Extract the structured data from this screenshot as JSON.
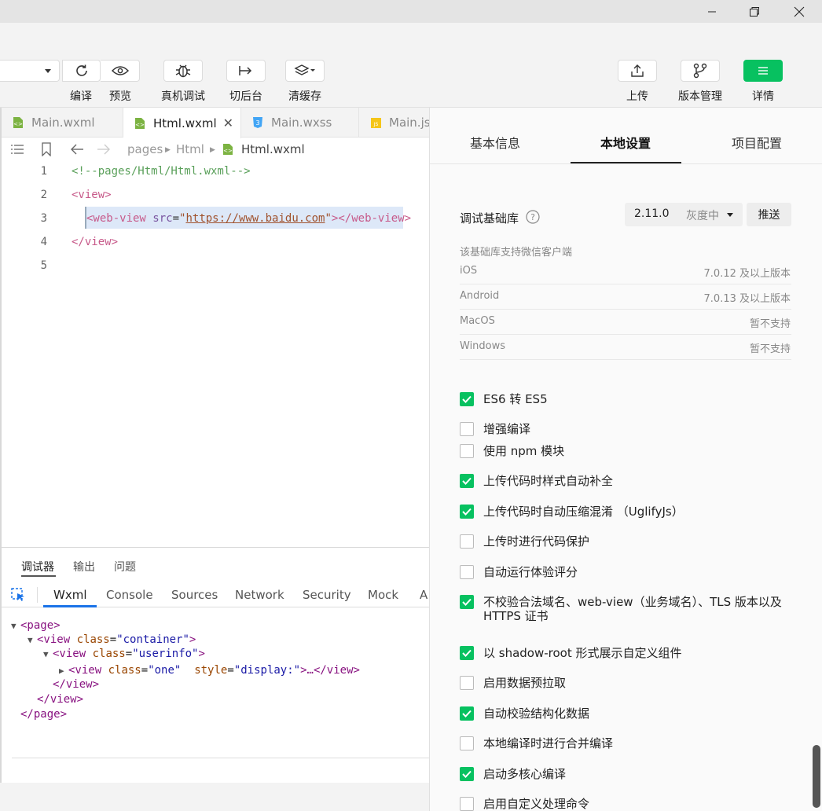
{
  "toolbar": {
    "compile_label": "编译",
    "preview_label": "预览",
    "realdebug_label": "真机调试",
    "background_label": "切后台",
    "clearcache_label": "清缓存",
    "upload_label": "上传",
    "version_label": "版本管理",
    "details_label": "详情"
  },
  "editor": {
    "tabs": [
      {
        "label": "Main.wxml"
      },
      {
        "label": "Html.wxml"
      },
      {
        "label": "Main.wxss"
      },
      {
        "label": "Main.js"
      }
    ],
    "breadcrumb": [
      "pages",
      "Html",
      "Html.wxml"
    ],
    "line_numbers": [
      "1",
      "2",
      "3",
      "4",
      "5"
    ],
    "code": {
      "l1": "<!--pages/Html/Html.wxml-->",
      "l2_tag": "<view>",
      "l3_open": "<web-view ",
      "l3_attr": "src",
      "l3_eq": "=",
      "l3_q1": "\"",
      "l3_url": "https://www.baidu.com",
      "l3_q2": "\"",
      "l3_close": "></web-view>",
      "l4_tag": "</view>"
    }
  },
  "debugger": {
    "top_tabs": [
      "调试器",
      "输出",
      "问题"
    ],
    "dev_tabs": [
      "Wxml",
      "Console",
      "Sources",
      "Network",
      "Security",
      "Mock",
      "A"
    ],
    "tree": {
      "page_open": "<page>",
      "view_open": "<view",
      "class_attr": "class",
      "container": "\"container\"",
      "userinfo": "\"userinfo\"",
      "one": "\"one\"",
      "style_attr": "style",
      "style_val": "\"display:\"",
      "ellipsis": ">…</view>",
      "gt": ">",
      "eq": "=",
      "view_close": "</view>",
      "page_close": "</page>"
    }
  },
  "panel": {
    "tabs": [
      "基本信息",
      "本地设置",
      "项目配置"
    ],
    "lib_label": "调试基础库",
    "lib_version": "2.11.0",
    "lib_channel": "灰度中",
    "push_label": "推送",
    "support_title": "该基础库支持微信客户端",
    "support": [
      {
        "platform": "iOS",
        "value": "7.0.12 及以上版本"
      },
      {
        "platform": "Android",
        "value": "7.0.13 及以上版本"
      },
      {
        "platform": "MacOS",
        "value": "暂不支持"
      },
      {
        "platform": "Windows",
        "value": "暂不支持"
      }
    ],
    "options": [
      {
        "label": "ES6 转 ES5",
        "checked": true
      },
      {
        "label": "增强编译",
        "checked": false
      },
      {
        "label": "使用 npm 模块",
        "checked": false
      },
      {
        "label": "上传代码时样式自动补全",
        "checked": true
      },
      {
        "label": "上传代码时自动压缩混淆 （UglifyJs）",
        "checked": true
      },
      {
        "label": "上传时进行代码保护",
        "checked": false
      },
      {
        "label": "自动运行体验评分",
        "checked": false
      },
      {
        "label": "不校验合法域名、web-view（业务域名）、TLS 版本以及 HTTPS 证书",
        "checked": true
      },
      {
        "label": "以 shadow-root 形式展示自定义组件",
        "checked": true
      },
      {
        "label": "启用数据预拉取",
        "checked": false
      },
      {
        "label": "自动校验结构化数据",
        "checked": true
      },
      {
        "label": "本地编译时进行合并编译",
        "checked": false
      },
      {
        "label": "启动多核心编译",
        "checked": true
      },
      {
        "label": "启用自定义处理命令",
        "checked": false
      }
    ]
  },
  "colors": {
    "accent": "#07c160",
    "link": "#1a73e8"
  }
}
